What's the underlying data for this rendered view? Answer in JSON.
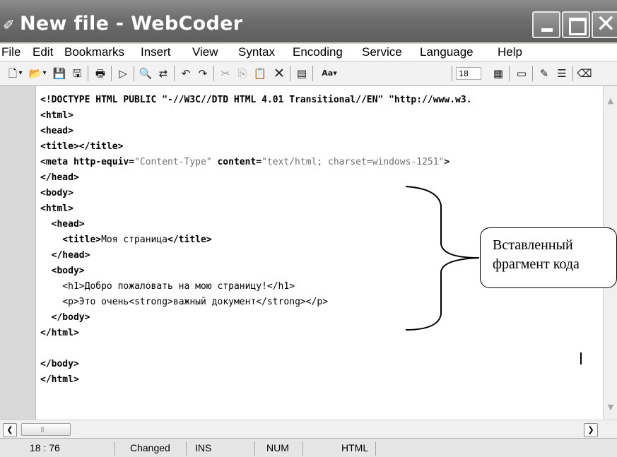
{
  "window": {
    "title": "New file - WebCoder"
  },
  "menu": [
    "File",
    "Edit",
    "Bookmarks",
    "Insert",
    "View",
    "Syntax",
    "Encoding",
    "Service",
    "Language",
    "Help"
  ],
  "toolbar": {
    "icons": [
      "new-file-icon",
      "dropdown-icon",
      "open-file-icon",
      "dropdown-icon",
      "save-icon",
      "save-all-icon",
      "print-icon",
      "run-icon",
      "find-icon",
      "replace-icon",
      "undo-icon",
      "redo-icon",
      "cut-icon",
      "copy-icon",
      "paste-icon",
      "delete-icon",
      "format-icon",
      "font-icon",
      "align-icon",
      "window-icon",
      "pen-icon",
      "list-icon",
      "eraser-icon"
    ],
    "font_size": "18"
  },
  "code": {
    "lines": [
      [
        "<!DOCTYPE HTML PUBLIC ",
        "\"-//W3C//DTD HTML 4.01 Transitional//EN\"",
        " \"http://www.w3."
      ],
      [
        "<html>"
      ],
      [
        "<head>"
      ],
      [
        "<title></title>"
      ],
      [
        "<meta http-equiv=",
        "\"Content-Type\"",
        " content=",
        "\"text/html; charset=windows-1251\"",
        ">"
      ],
      [
        "</head>"
      ],
      [
        "<body>"
      ],
      [
        "<html>"
      ],
      [
        "  <head>"
      ],
      [
        "    <title>",
        "Моя страница",
        "</title>"
      ],
      [
        "  </head>"
      ],
      [
        "  <body>"
      ],
      [
        "    <h1>",
        "Добро пожаловать на мою страницу!",
        "</h1>"
      ],
      [
        "    <p>",
        "Это очень",
        "<strong>",
        "важный документ",
        "</strong></p>"
      ],
      [
        "  </body>"
      ],
      [
        "</html>"
      ],
      [
        ""
      ],
      [
        "</body>"
      ],
      [
        "</html>"
      ]
    ]
  },
  "status": {
    "position": "18 : 76",
    "state": "Changed",
    "insert_mode": "INS",
    "num_lock": "NUM",
    "syntax": "HTML"
  },
  "annotation": {
    "line1": "Вставленный",
    "line2": "фрагмент кода"
  }
}
